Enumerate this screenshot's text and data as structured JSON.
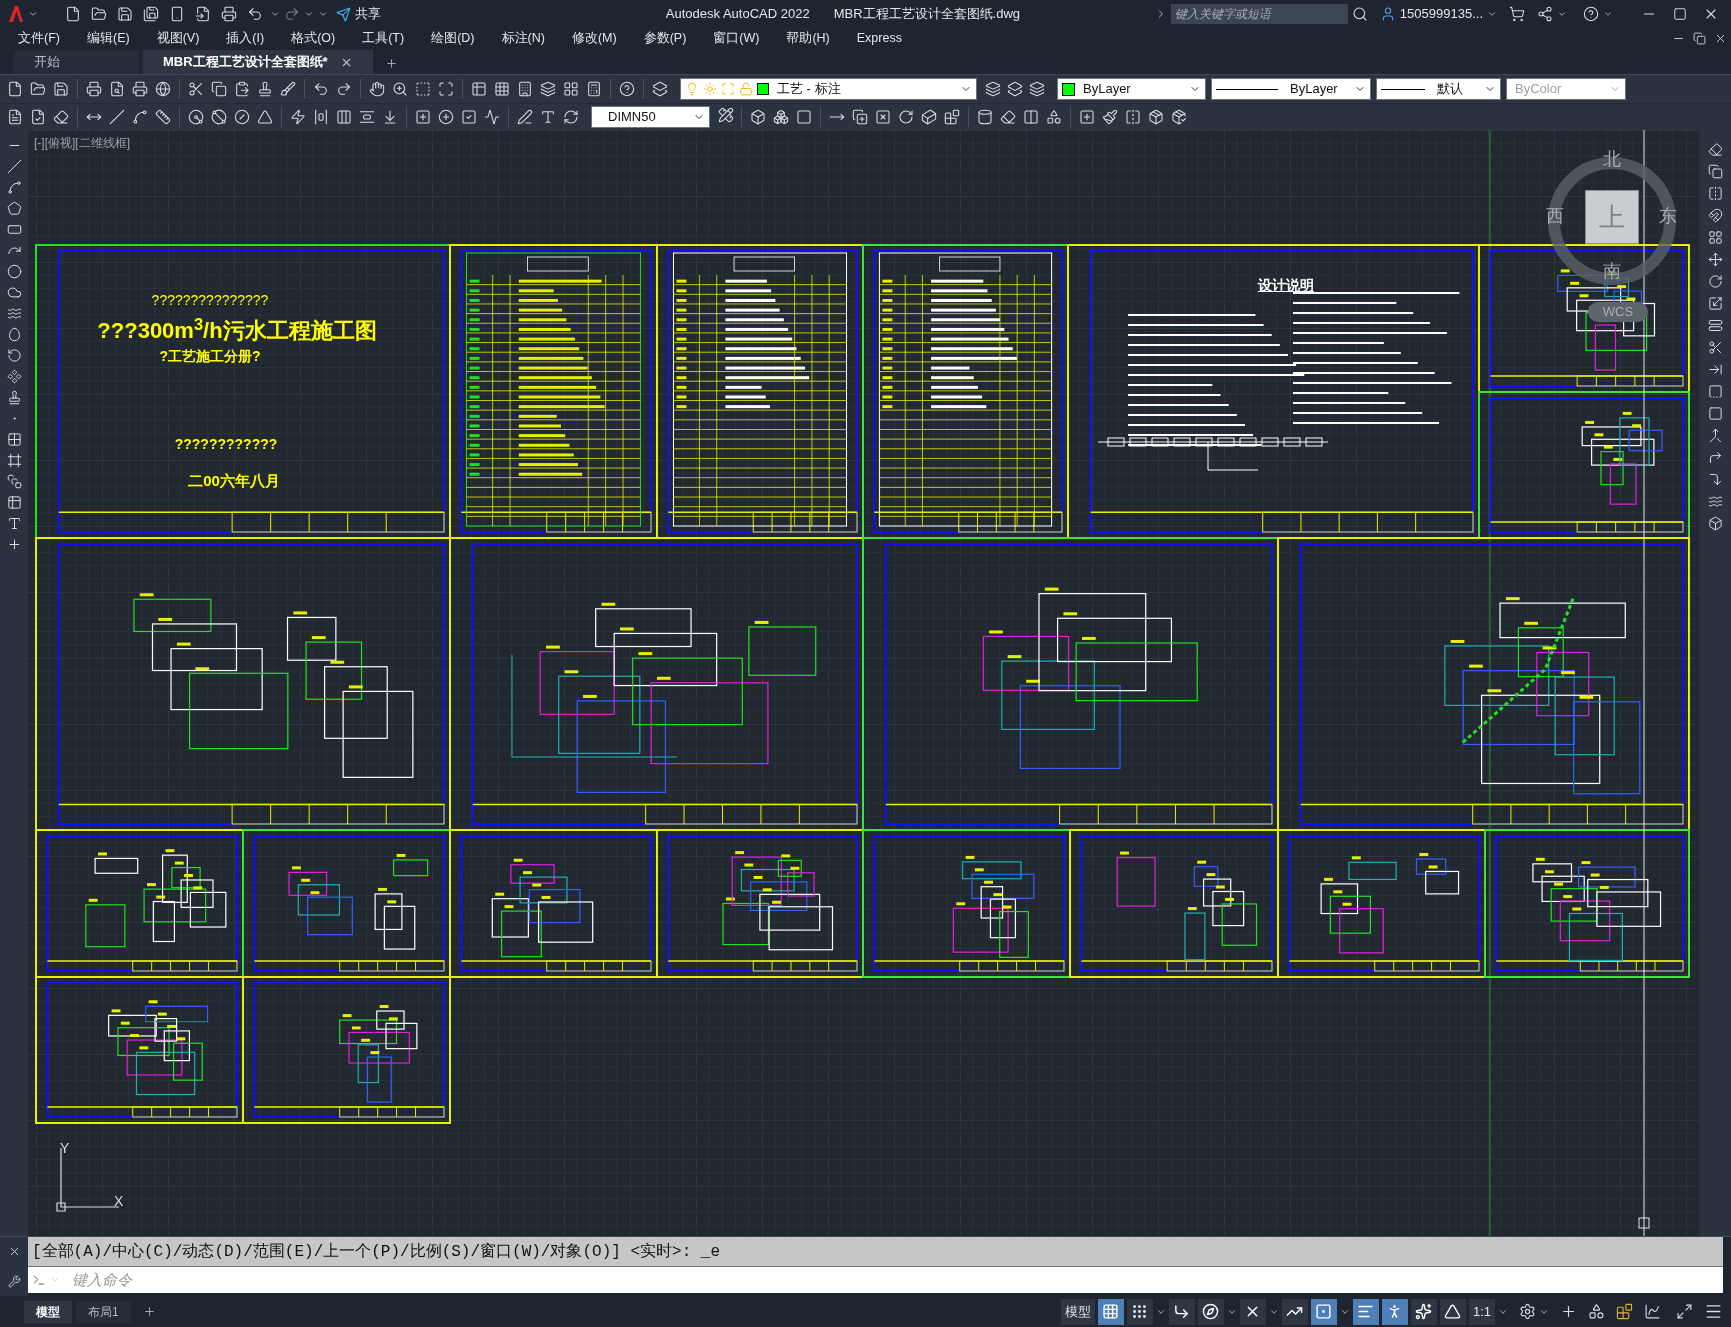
{
  "title_bar": {
    "share": "共享",
    "app_title": "Autodesk AutoCAD 2022",
    "file_name": "MBR工程工艺设计全套图纸.dwg",
    "search": {
      "placeholder": "键入关键字或短语"
    },
    "user": "1505999135..."
  },
  "menu": [
    "文件(F)",
    "编辑(E)",
    "视图(V)",
    "插入(I)",
    "格式(O)",
    "工具(T)",
    "绘图(D)",
    "标注(N)",
    "修改(M)",
    "参数(P)",
    "窗口(W)",
    "帮助(H)",
    "Express"
  ],
  "doc_tabs": [
    {
      "label": "开始",
      "selected": false
    },
    {
      "label": "MBR工程工艺设计全套图纸*",
      "selected": true
    }
  ],
  "toolbar": {
    "layer": "工艺 - 标注",
    "color_setting": "ByLayer",
    "linetype": "ByLayer",
    "lineweight": "默认",
    "plot_style": "ByColor",
    "dim_style": "DIMN50"
  },
  "viewport_label": "[-][俯视][二维线框]",
  "viewcube": {
    "north": "北",
    "west": "西",
    "east": "东",
    "south": "南",
    "face": "上",
    "ucs": "WCS"
  },
  "sheets": [
    {
      "kind": "cover",
      "lines": [
        "???????????????",
        "???300m$^{3}$/h污水工程施工图",
        "?工艺施工分册?",
        "????????????",
        "二00六年八月"
      ]
    },
    {
      "kind": "index"
    },
    {
      "kind": "table"
    },
    {
      "kind": "table"
    },
    {
      "kind": "notes",
      "title": "设计说明"
    },
    {
      "kind": "section"
    },
    {
      "kind": "plan"
    },
    {
      "kind": "site"
    },
    {
      "kind": "process"
    },
    {
      "kind": "plan"
    },
    {
      "kind": "isometric"
    },
    {
      "kind": "site"
    },
    {
      "kind": "plan"
    },
    {
      "kind": "plan"
    },
    {
      "kind": "section"
    },
    {
      "kind": "plan"
    },
    {
      "kind": "plan"
    },
    {
      "kind": "plan"
    },
    {
      "kind": "section"
    },
    {
      "kind": "section"
    },
    {
      "kind": "plan"
    }
  ],
  "ucs_axes": {
    "y": "Y",
    "x": "X"
  },
  "command_line": {
    "history": "[全部(A)/中心(C)/动态(D)/范围(E)/上一个(P)/比例(S)/窗口(W)/对象(O)] <实时>: _e",
    "placeholder": "键入命令"
  },
  "layout_tabs": [
    {
      "label": "模型",
      "selected": true
    },
    {
      "label": "布局1",
      "selected": false
    }
  ],
  "status_bar": {
    "space": "模型",
    "scale": "1:1"
  },
  "status_toggles": [
    {
      "kind": "grid",
      "on": true
    },
    {
      "kind": "snap",
      "on": false
    },
    {
      "kind": "ortho",
      "on": false
    },
    {
      "kind": "polar",
      "on": false
    },
    {
      "kind": "isodraft",
      "on": false
    },
    {
      "kind": "tracking",
      "on": false
    },
    {
      "kind": "osnap",
      "on": true
    },
    {
      "kind": "lineweight",
      "on": true
    },
    {
      "kind": "annotation",
      "on": true
    },
    {
      "kind": "autoscale",
      "on": false
    },
    {
      "kind": "annoscale",
      "on": false
    }
  ]
}
